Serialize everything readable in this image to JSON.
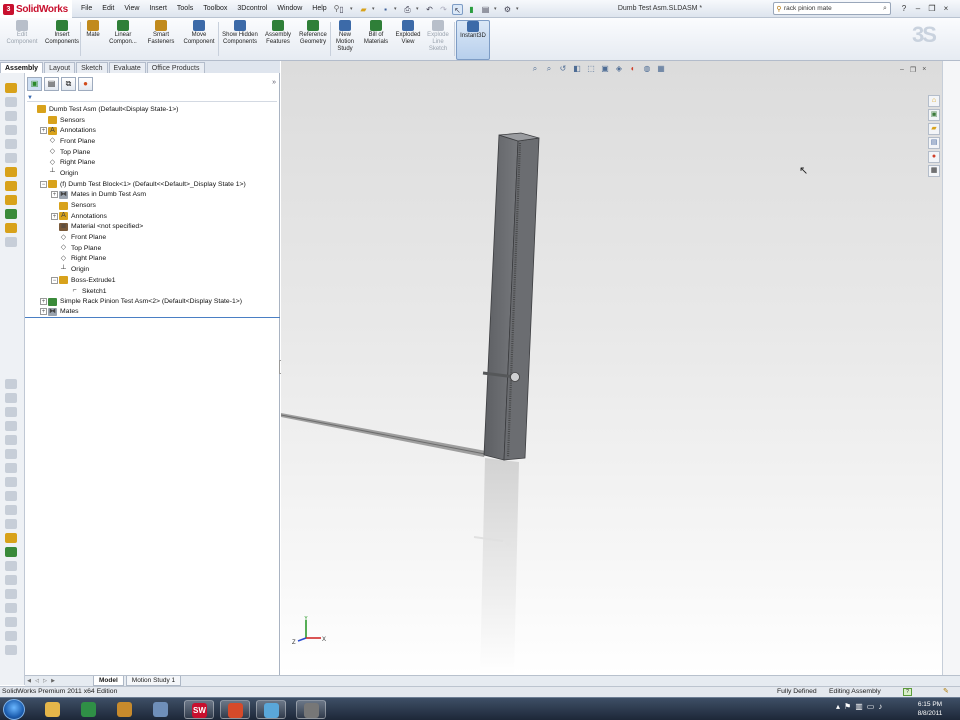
{
  "app": {
    "logo_text": "SolidWorks",
    "document_title": "Dumb Test Asm.SLDASM *"
  },
  "menu": [
    "File",
    "Edit",
    "View",
    "Insert",
    "Tools",
    "Toolbox",
    "3Dcontrol",
    "Window",
    "Help"
  ],
  "search": {
    "value": "rack pinion mate"
  },
  "commands": [
    {
      "label": "Edit Component",
      "dim": true
    },
    {
      "label": "Insert Components",
      "dim": false
    },
    {
      "label": "Mate",
      "dim": false
    },
    {
      "label": "Linear Compon...",
      "dim": false
    },
    {
      "label": "Smart Fasteners",
      "dim": false
    },
    {
      "label": "Move Component",
      "dim": false
    },
    {
      "label": "Show Hidden Components",
      "dim": false
    },
    {
      "label": "Assembly Features",
      "dim": false
    },
    {
      "label": "Reference Geometry",
      "dim": false
    },
    {
      "label": "New Motion Study",
      "dim": false
    },
    {
      "label": "Bill of Materials",
      "dim": false
    },
    {
      "label": "Exploded View",
      "dim": false
    },
    {
      "label": "Explode Line Sketch",
      "dim": true
    },
    {
      "label": "Instant3D",
      "dim": false,
      "selected": true
    }
  ],
  "command_tabs": [
    "Assembly",
    "Layout",
    "Sketch",
    "Evaluate",
    "Office Products"
  ],
  "active_command_tab": "Assembly",
  "tree": [
    {
      "label": "Dumb Test Asm  (Default<Display State-1>)",
      "indent": 0,
      "expander": "",
      "icon": "assembly-icon"
    },
    {
      "label": "Sensors",
      "indent": 1,
      "expander": "",
      "icon": "sensors-icon"
    },
    {
      "label": "Annotations",
      "indent": 1,
      "expander": "+",
      "icon": "annotations-icon"
    },
    {
      "label": "Front Plane",
      "indent": 1,
      "expander": "",
      "icon": "plane-icon"
    },
    {
      "label": "Top Plane",
      "indent": 1,
      "expander": "",
      "icon": "plane-icon"
    },
    {
      "label": "Right Plane",
      "indent": 1,
      "expander": "",
      "icon": "plane-icon"
    },
    {
      "label": "Origin",
      "indent": 1,
      "expander": "",
      "icon": "origin-icon"
    },
    {
      "label": "(f) Dumb Test Block<1> (Default<<Default>_Display State 1>)",
      "indent": 1,
      "expander": "−",
      "icon": "part-icon"
    },
    {
      "label": "Mates in Dumb Test Asm",
      "indent": 2,
      "expander": "+",
      "icon": "mates-icon"
    },
    {
      "label": "Sensors",
      "indent": 2,
      "expander": "",
      "icon": "sensors-icon"
    },
    {
      "label": "Annotations",
      "indent": 2,
      "expander": "+",
      "icon": "annotations-icon"
    },
    {
      "label": "Material <not specified>",
      "indent": 2,
      "expander": "",
      "icon": "material-icon"
    },
    {
      "label": "Front Plane",
      "indent": 2,
      "expander": "",
      "icon": "plane-icon"
    },
    {
      "label": "Top Plane",
      "indent": 2,
      "expander": "",
      "icon": "plane-icon"
    },
    {
      "label": "Right Plane",
      "indent": 2,
      "expander": "",
      "icon": "plane-icon"
    },
    {
      "label": "Origin",
      "indent": 2,
      "expander": "",
      "icon": "origin-icon"
    },
    {
      "label": "Boss-Extrude1",
      "indent": 2,
      "expander": "−",
      "icon": "extrude-icon"
    },
    {
      "label": "Sketch1",
      "indent": 3,
      "expander": "",
      "icon": "sketch-icon"
    },
    {
      "label": "Simple Rack Pinion Test Asm<2> (Default<Display State-1>)",
      "indent": 1,
      "expander": "+",
      "icon": "subassembly-icon"
    },
    {
      "label": "Mates",
      "indent": 1,
      "expander": "+",
      "icon": "mates-icon"
    }
  ],
  "bottom_tabs": [
    "Model",
    "Motion Study 1"
  ],
  "active_bottom_tab": "Model",
  "status": {
    "product": "SolidWorks Premium 2011 x64 Edition",
    "defined": "Fully Defined",
    "mode": "Editing Assembly"
  },
  "triad": {
    "x_label": "X",
    "y_label": "Y",
    "z_label": "Z"
  },
  "clock": {
    "time": "6:15 PM",
    "date": "8/8/2011"
  },
  "taskbar_apps": [
    {
      "name": "explorer",
      "color": "#e5b64a"
    },
    {
      "name": "chrome",
      "color": "#2f8f46"
    },
    {
      "name": "gimp",
      "color": "#c78a2c"
    },
    {
      "name": "notepad",
      "color": "#6f8fb9"
    },
    {
      "name": "solidworks",
      "color": "#c8102e",
      "glyph": "SW"
    },
    {
      "name": "unknown",
      "color": "#d64a2a"
    },
    {
      "name": "cmd-window",
      "color": "#5aa7d9"
    },
    {
      "name": "window",
      "color": "#777777"
    }
  ],
  "colors": {
    "accent": "#c8102e",
    "selection_line": "#4a7fc4",
    "part_dark": "#5b5d61",
    "part_face": "#7a7c80"
  }
}
